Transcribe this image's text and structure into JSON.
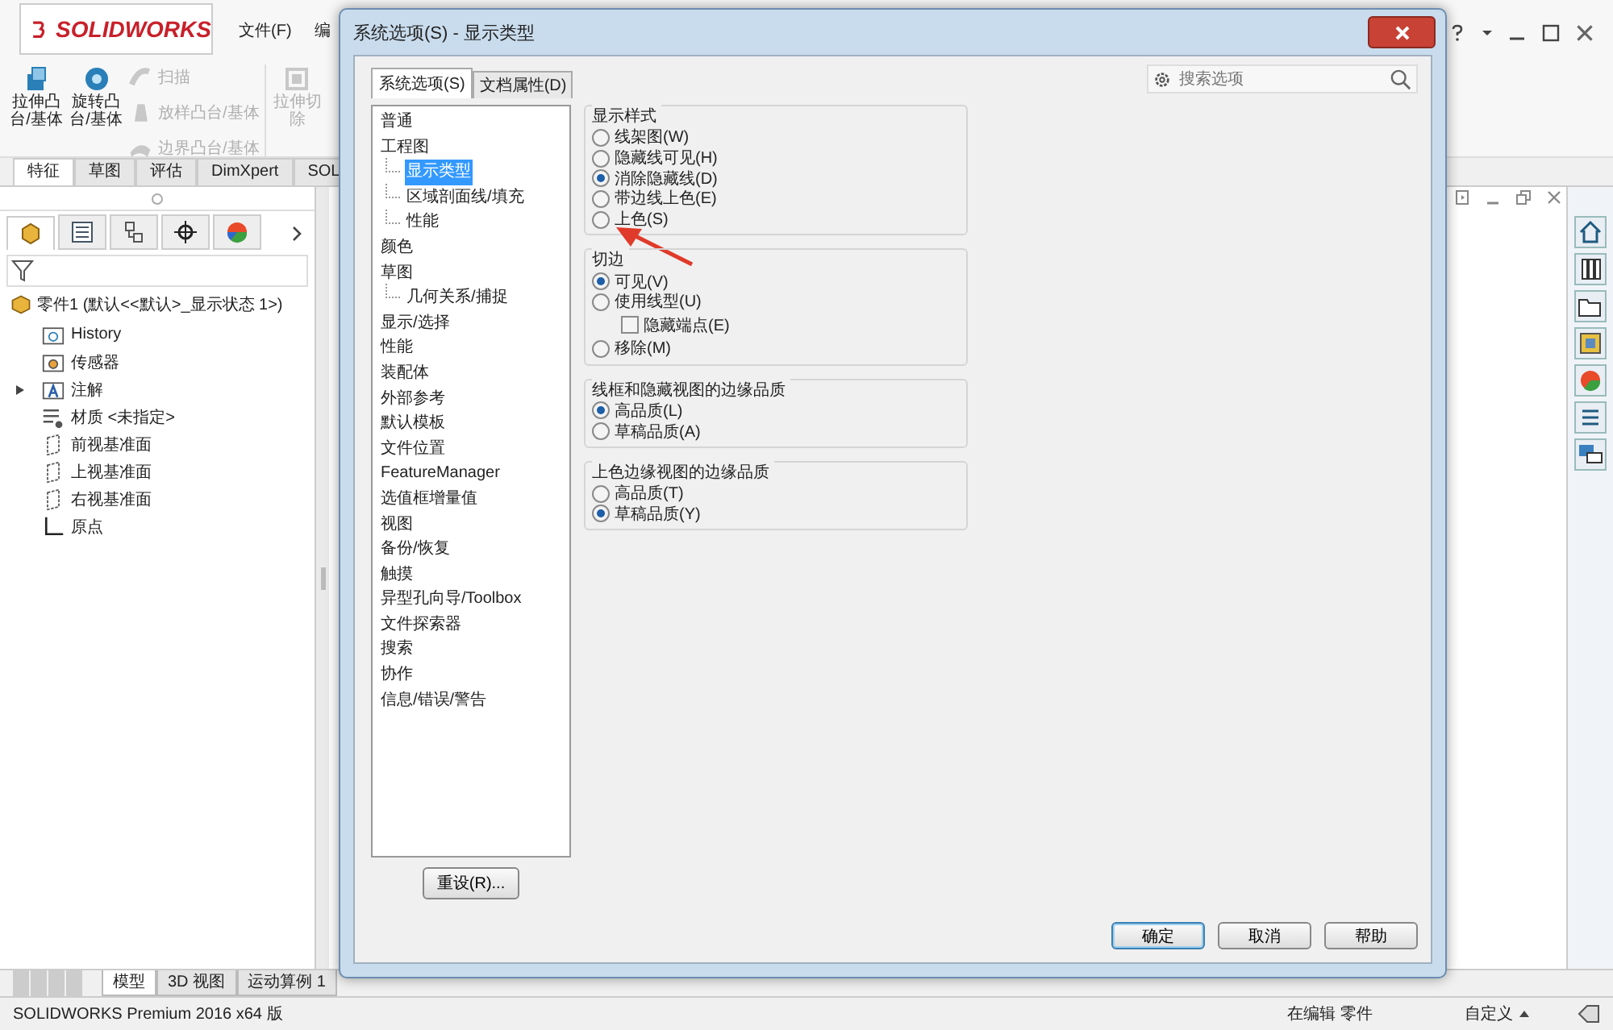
{
  "app": {
    "logo": "SOLIDWORKS",
    "menu": [
      "文件(F)",
      "编"
    ],
    "toolbar": [
      {
        "label": "拉伸凸台/基体",
        "kind": "large",
        "disabled": false
      },
      {
        "label": "旋转凸台/基体",
        "kind": "large",
        "disabled": false
      },
      {
        "label": "扫描",
        "kind": "small",
        "disabled": true
      },
      {
        "label": "放样凸台/基体",
        "kind": "small",
        "disabled": true
      },
      {
        "label": "边界凸台/基体",
        "kind": "small",
        "disabled": true
      },
      {
        "label": "拉伸切除",
        "kind": "large",
        "disabled": true
      }
    ],
    "command_tabs": [
      {
        "label": "特征",
        "selected": true
      },
      {
        "label": "草图",
        "selected": false
      },
      {
        "label": "评估",
        "selected": false
      },
      {
        "label": "DimXpert",
        "selected": false
      },
      {
        "label": "SOL",
        "selected": false
      }
    ],
    "feature_tree": {
      "root": "零件1 (默认<<默认>_显示状态 1>)",
      "items": [
        {
          "label": "History",
          "kind": "history"
        },
        {
          "label": "传感器",
          "kind": "sensor"
        },
        {
          "label": "注解",
          "kind": "annotation",
          "expanded": false
        },
        {
          "label": "材质 <未指定>",
          "kind": "material"
        },
        {
          "label": "前视基准面",
          "kind": "plane"
        },
        {
          "label": "上视基准面",
          "kind": "plane"
        },
        {
          "label": "右视基准面",
          "kind": "plane"
        },
        {
          "label": "原点",
          "kind": "origin"
        }
      ]
    },
    "bottom_tabs": [
      {
        "label": "模型",
        "selected": true
      },
      {
        "label": "3D 视图",
        "selected": false
      },
      {
        "label": "运动算例 1",
        "selected": false
      }
    ],
    "status_bar": [
      "SOLIDWORKS Premium 2016 x64 版",
      "在编辑 零件",
      "自定义"
    ]
  },
  "dialog": {
    "title": "系统选项(S) - 显示类型",
    "search": {
      "placeholder": "搜索选项"
    },
    "tabs": [
      {
        "label": "系统选项(S)",
        "selected": true
      },
      {
        "label": "文档属性(D)",
        "selected": false
      }
    ],
    "tree": [
      {
        "label": "普通",
        "selected": false
      },
      {
        "label": "工程图",
        "selected": false,
        "children": [
          {
            "label": "显示类型",
            "selected": true
          },
          {
            "label": "区域剖面线/填充",
            "selected": false
          },
          {
            "label": "性能",
            "selected": false
          }
        ]
      },
      {
        "label": "颜色",
        "selected": false
      },
      {
        "label": "草图",
        "selected": false,
        "children": [
          {
            "label": "几何关系/捕捉",
            "selected": false
          }
        ]
      },
      {
        "label": "显示/选择",
        "selected": false
      },
      {
        "label": "性能",
        "selected": false
      },
      {
        "label": "装配体",
        "selected": false
      },
      {
        "label": "外部参考",
        "selected": false
      },
      {
        "label": "默认模板",
        "selected": false
      },
      {
        "label": "文件位置",
        "selected": false
      },
      {
        "label": "FeatureManager",
        "selected": false
      },
      {
        "label": "选值框增量值",
        "selected": false
      },
      {
        "label": "视图",
        "selected": false
      },
      {
        "label": "备份/恢复",
        "selected": false
      },
      {
        "label": "触摸",
        "selected": false
      },
      {
        "label": "异型孔向导/Toolbox",
        "selected": false
      },
      {
        "label": "文件探索器",
        "selected": false
      },
      {
        "label": "搜索",
        "selected": false
      },
      {
        "label": "协作",
        "selected": false
      },
      {
        "label": "信息/错误/警告",
        "selected": false
      }
    ],
    "reset_button": "重设(R)...",
    "groups": [
      {
        "title": "显示样式",
        "options": [
          {
            "kind": "radio",
            "label": "线架图(W)",
            "selected": false
          },
          {
            "kind": "radio",
            "label": "隐藏线可见(H)",
            "selected": false
          },
          {
            "kind": "radio",
            "label": "消除隐藏线(D)",
            "selected": true
          },
          {
            "kind": "radio",
            "label": "带边线上色(E)",
            "selected": false
          },
          {
            "kind": "radio",
            "label": "上色(S)",
            "selected": false
          }
        ]
      },
      {
        "title": "切边",
        "options": [
          {
            "kind": "radio",
            "label": "可见(V)",
            "selected": true
          },
          {
            "kind": "radio",
            "label": "使用线型(U)",
            "selected": false
          },
          {
            "kind": "checkbox",
            "label": "隐藏端点(E)",
            "checked": false
          },
          {
            "kind": "radio",
            "label": "移除(M)",
            "selected": false
          }
        ]
      },
      {
        "title": "线框和隐藏视图的边缘品质",
        "options": [
          {
            "kind": "radio",
            "label": "高品质(L)",
            "selected": true
          },
          {
            "kind": "radio",
            "label": "草稿品质(A)",
            "selected": false
          }
        ]
      },
      {
        "title": "上色边缘视图的边缘品质",
        "options": [
          {
            "kind": "radio",
            "label": "高品质(T)",
            "selected": false
          },
          {
            "kind": "radio",
            "label": "草稿品质(Y)",
            "selected": true
          }
        ]
      }
    ],
    "buttons": [
      {
        "label": "确定",
        "default": true
      },
      {
        "label": "取消",
        "default": false
      },
      {
        "label": "帮助",
        "default": false
      }
    ]
  }
}
